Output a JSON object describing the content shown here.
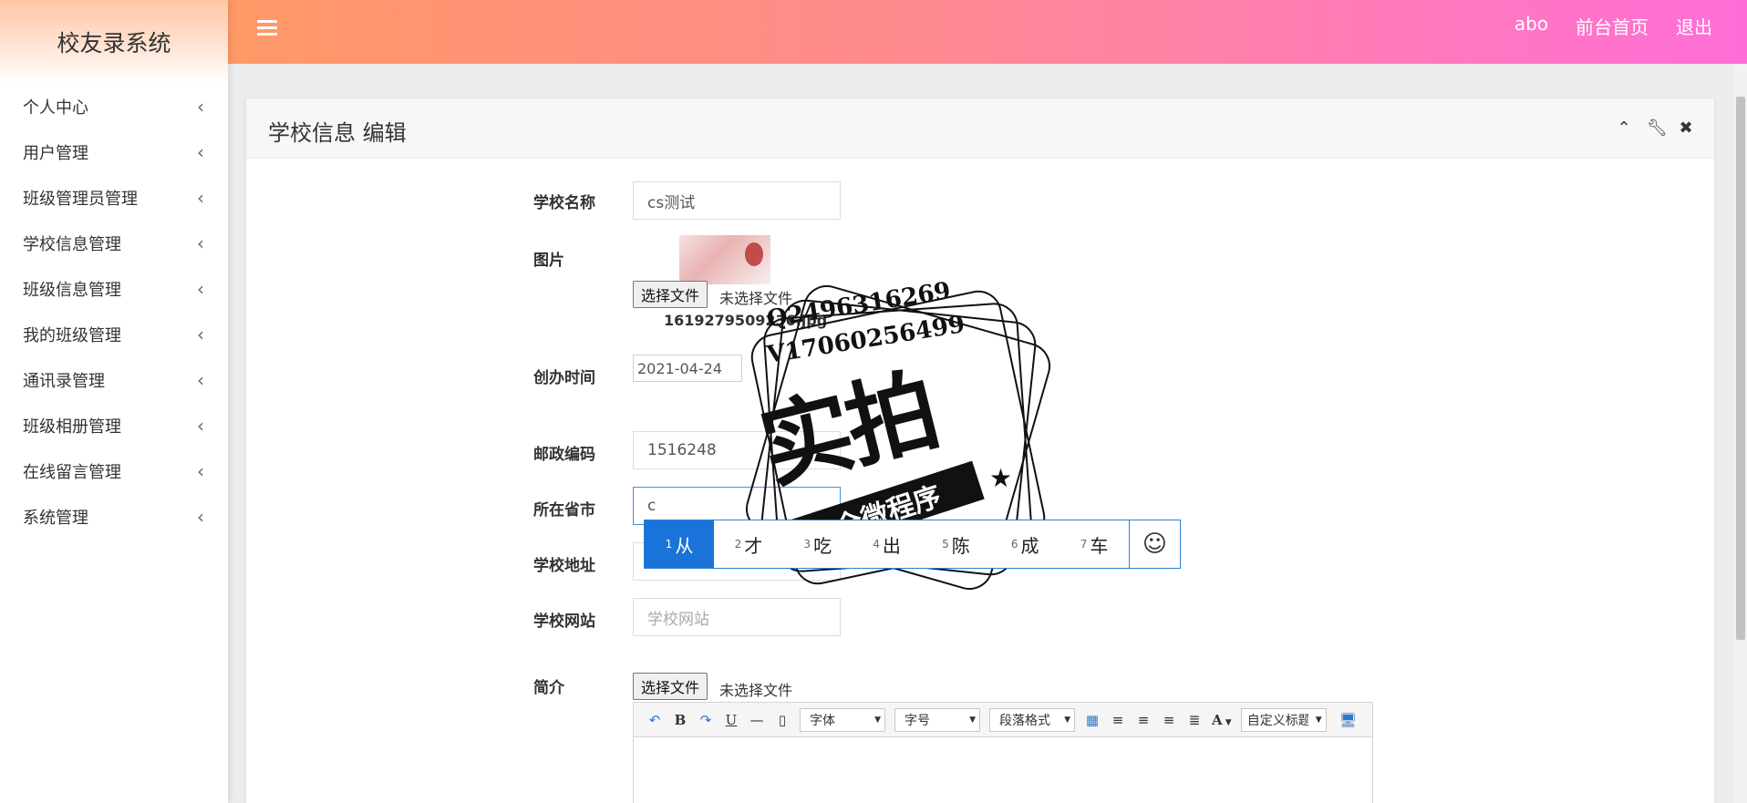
{
  "app": {
    "title": "校友录系统"
  },
  "header": {
    "user": "abo",
    "home_link": "前台首页",
    "logout": "退出"
  },
  "sidebar": {
    "items": [
      {
        "label": "个人中心"
      },
      {
        "label": "用户管理"
      },
      {
        "label": "班级管理员管理"
      },
      {
        "label": "学校信息管理"
      },
      {
        "label": "班级信息管理"
      },
      {
        "label": "我的班级管理"
      },
      {
        "label": "通讯录管理"
      },
      {
        "label": "班级相册管理"
      },
      {
        "label": "在线留言管理"
      },
      {
        "label": "系统管理"
      }
    ]
  },
  "panel": {
    "title": "学校信息 编辑"
  },
  "form": {
    "name": {
      "label": "学校名称",
      "value": "cs测试"
    },
    "image": {
      "label": "图片",
      "button": "选择文件",
      "status": "未选择文件",
      "filename": "1619279509236.jpg"
    },
    "founded": {
      "label": "创办时间",
      "value": "2021-04-24"
    },
    "postcode": {
      "label": "邮政编码",
      "value": "1516248"
    },
    "province": {
      "label": "所在省市",
      "value": "c"
    },
    "address": {
      "label": "学校地址"
    },
    "website": {
      "label": "学校网站",
      "placeholder": "学校网站"
    },
    "intro": {
      "label": "简介",
      "button": "选择文件",
      "status": "未选择文件"
    }
  },
  "ime": {
    "candidates": [
      {
        "num": "1",
        "text": "从"
      },
      {
        "num": "2",
        "text": "才"
      },
      {
        "num": "3",
        "text": "吃"
      },
      {
        "num": "4",
        "text": "出"
      },
      {
        "num": "5",
        "text": "陈"
      },
      {
        "num": "6",
        "text": "成"
      },
      {
        "num": "7",
        "text": "车"
      }
    ],
    "emoji": "☺"
  },
  "editor": {
    "font": "字体",
    "size": "字号",
    "paragraph": "段落格式",
    "font_color": "A",
    "custom_title": "自定义标题"
  },
  "watermark": {
    "line1": "Q2496316269",
    "line2": "V17060256499",
    "main": "实拍",
    "ribbon": "全微程序"
  }
}
